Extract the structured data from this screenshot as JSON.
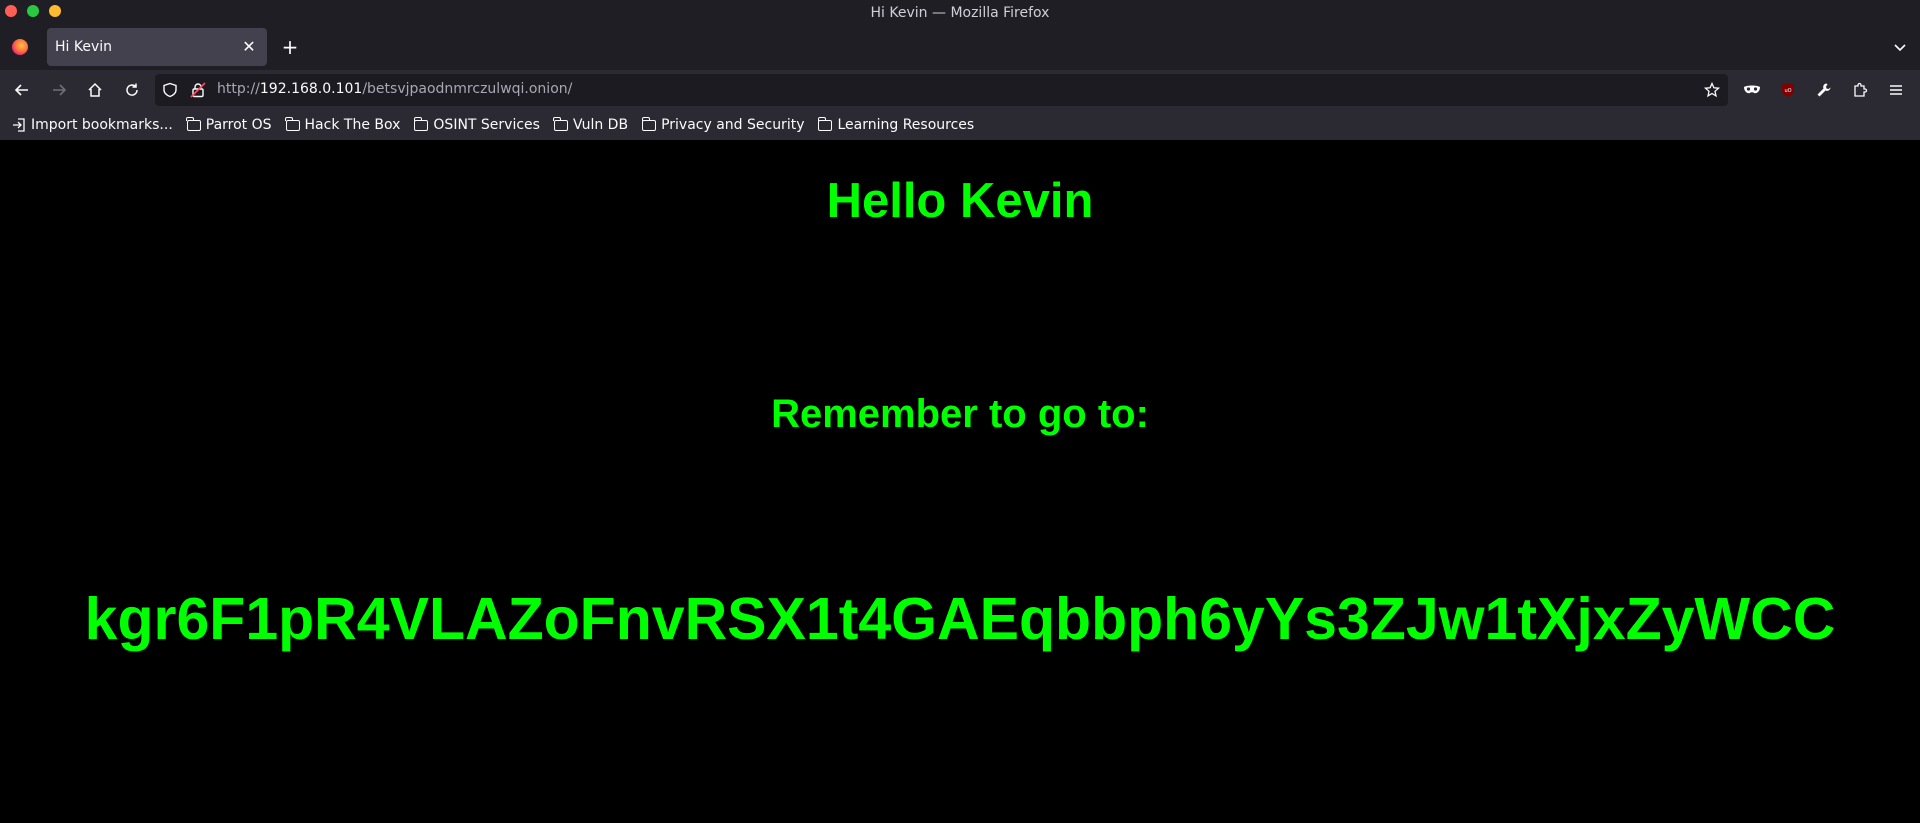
{
  "window": {
    "title": "Hi Kevin — Mozilla Firefox"
  },
  "tabs": [
    {
      "label": "Hi Kevin",
      "active": true
    }
  ],
  "urlbar": {
    "scheme": "http://",
    "host": "192.168.0.101",
    "path": "/betsvjpaodnmrczulwqi.onion/"
  },
  "bookmarks": [
    {
      "label": "Import bookmarks...",
      "icon": "import-icon"
    },
    {
      "label": "Parrot OS",
      "icon": "folder-icon"
    },
    {
      "label": "Hack The Box",
      "icon": "folder-icon"
    },
    {
      "label": "OSINT Services",
      "icon": "folder-icon"
    },
    {
      "label": "Vuln DB",
      "icon": "folder-icon"
    },
    {
      "label": "Privacy and Security",
      "icon": "folder-icon"
    },
    {
      "label": "Learning Resources",
      "icon": "folder-icon"
    }
  ],
  "page": {
    "heading": "Hello Kevin",
    "subheading": "Remember to go to:",
    "code": "kgr6F1pR4VLAZoFnvRSX1t4GAEqbbph6yYs3ZJw1tXjxZyWCC",
    "text_color": "#00ff00",
    "background": "#000000"
  }
}
